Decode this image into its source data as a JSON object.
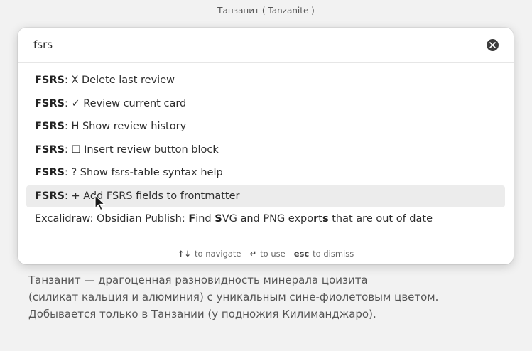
{
  "window": {
    "title": "Танзанит ( Tanzanite )"
  },
  "document": {
    "lines": [
      "Танзанит — драгоценная разновидность минерала цоизита",
      "(силикат кальция и алюминия) с уникальным сине-фиолетовым цветом.",
      "Добывается только в Танзании (у подножия Килиманджаро)."
    ]
  },
  "palette": {
    "search": {
      "value": "fsrs",
      "placeholder": ""
    },
    "results": [
      {
        "prefix": "FSRS",
        "text": ": X Delete last review"
      },
      {
        "prefix": "FSRS",
        "text": ": ✓ Review current card"
      },
      {
        "prefix": "FSRS",
        "text": ": H Show review history"
      },
      {
        "prefix": "FSRS",
        "text": ": ☐ Insert review button block"
      },
      {
        "prefix": "FSRS",
        "text": ": ? Show fsrs-table syntax help"
      },
      {
        "prefix": "FSRS",
        "text": ": + Add FSRS fields to frontmatter",
        "selected": true
      },
      {
        "text": "Excalidraw: Obsidian Publish: Find SVG and PNG exports that are out of date"
      }
    ],
    "footer": {
      "navigate": {
        "key": "↑↓",
        "label": "to navigate"
      },
      "use": {
        "key": "↵",
        "label": "to use"
      },
      "dismiss": {
        "key": "esc",
        "label": "to dismiss"
      }
    }
  },
  "icons": {
    "clear": "close-circle-icon",
    "cursor": "mouse-pointer-icon"
  },
  "colors": {
    "selected_bg": "#ececec",
    "palette_bg": "#ffffff",
    "page_bg": "#f2f2f2"
  }
}
